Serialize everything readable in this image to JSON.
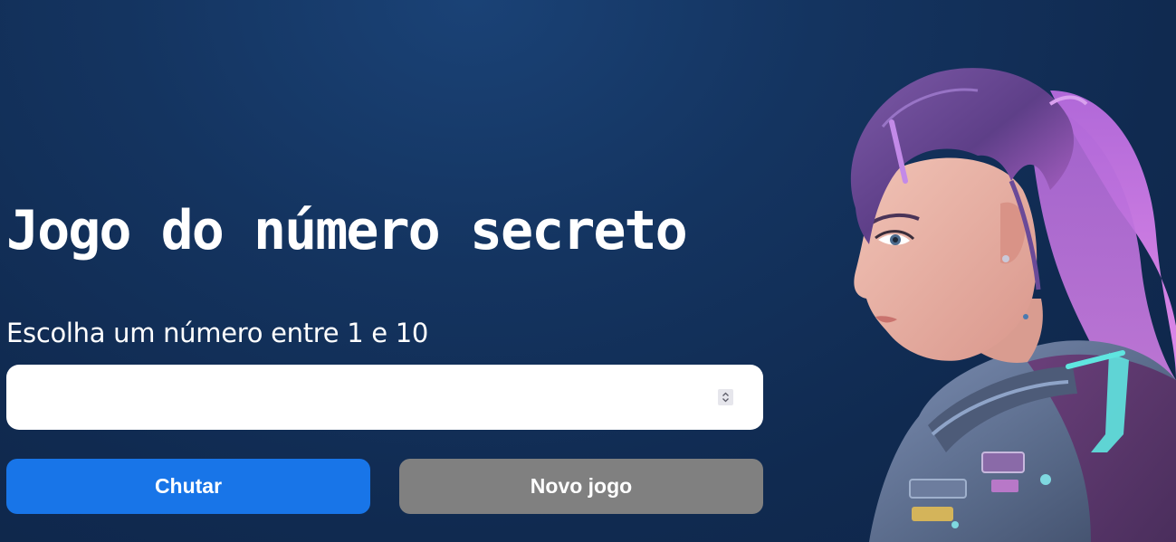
{
  "title": "Jogo do número secreto",
  "prompt": "Escolha um número entre 1 e 10",
  "input": {
    "value": "",
    "min": "1",
    "max": "10"
  },
  "buttons": {
    "guess_label": "Chutar",
    "new_game_label": "Novo jogo"
  },
  "colors": {
    "background": "#143460",
    "guess_button": "#1875e8",
    "new_game_button": "#808080",
    "text": "#ffffff"
  },
  "hero_image": {
    "icon": "astronaut-girl-illustration"
  }
}
